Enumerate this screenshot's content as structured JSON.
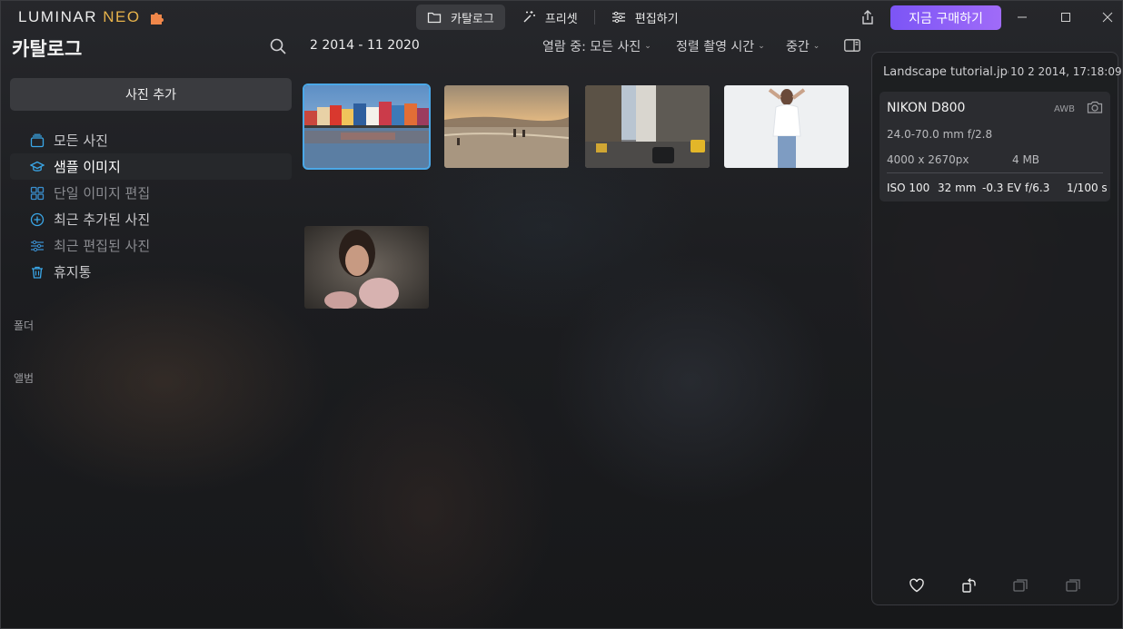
{
  "app": {
    "logo_text": "LUMINAR",
    "logo_accent": "NEO",
    "accent_color": "#8a5cf6"
  },
  "nav_tabs": [
    {
      "label": "카탈로그",
      "icon": "folder-icon",
      "active": true
    },
    {
      "label": "프리셋",
      "icon": "magic-wand-icon",
      "active": false
    },
    {
      "label": "편집하기",
      "icon": "sliders-icon",
      "active": false
    }
  ],
  "buy_button": "지금 구매하기",
  "header": {
    "title": "카탈로그",
    "date_range": "2 2014 - 11 2020",
    "view_filter": "열람 중: 모든 사진",
    "sort": "정렬 촬영 시간",
    "size": "중간"
  },
  "sidebar": {
    "add_photos": "사진 추가",
    "items": [
      {
        "label": "모든 사진",
        "icon": "stack-icon",
        "state": "normal"
      },
      {
        "label": "샘플 이미지",
        "icon": "graduation-cap-icon",
        "state": "active"
      },
      {
        "label": "단일 이미지 편집",
        "icon": "grid-icon",
        "state": "dim"
      },
      {
        "label": "최근 추가된 사진",
        "icon": "plus-circle-icon",
        "state": "normal"
      },
      {
        "label": "최근 편집된 사진",
        "icon": "sliders-icon",
        "state": "dim"
      },
      {
        "label": "휴지통",
        "icon": "trash-icon",
        "state": "normal"
      }
    ],
    "folders_label": "폴더",
    "albums_label": "앨범"
  },
  "thumbnails": [
    {
      "name": "colorful-houses-harbor",
      "selected": true
    },
    {
      "name": "beach-sunset",
      "selected": false
    },
    {
      "name": "city-street-taxis",
      "selected": false
    },
    {
      "name": "woman-white-shirt",
      "selected": false
    },
    {
      "name": "woman-portrait-pink",
      "selected": false
    }
  ],
  "info_panel": {
    "filename": "Landscape tutorial.jpg",
    "date": "10 2 2014, 17:18:09",
    "camera": "NIKON D800",
    "wb": "AWB",
    "lens": "24.0-70.0 mm f/2.8",
    "resolution": "4000 x 2670px",
    "filesize": "4 MB",
    "iso": "ISO 100",
    "focal": "32 mm",
    "ev": "-0.3 EV",
    "aperture": "f/6.3",
    "shutter": "1/100 s"
  }
}
